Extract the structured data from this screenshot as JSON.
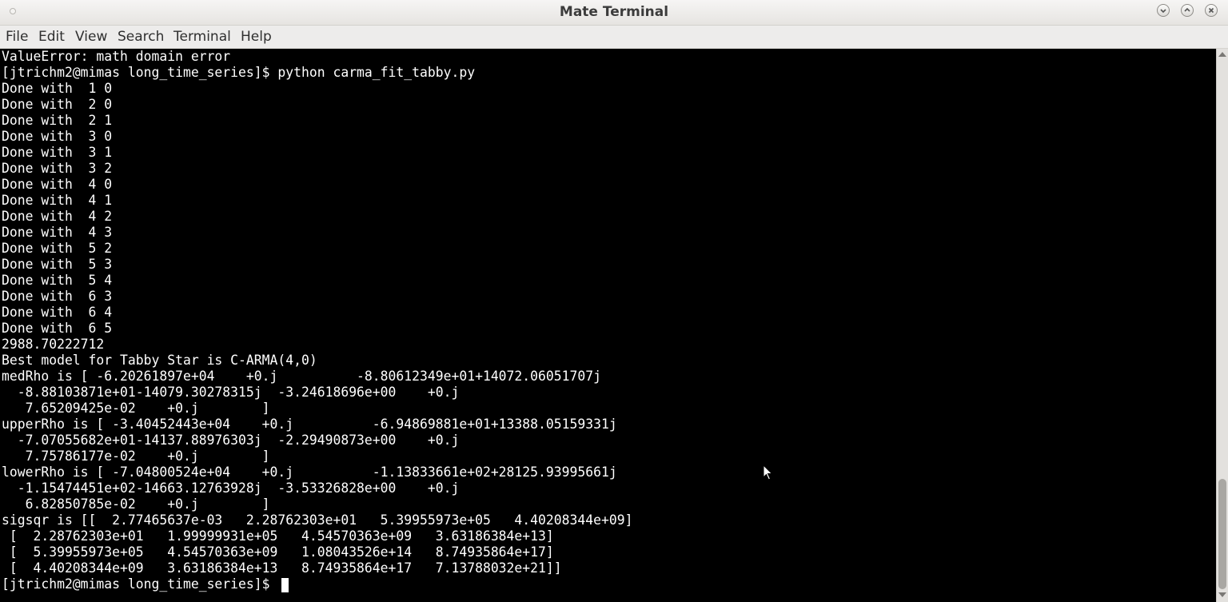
{
  "window": {
    "title": "Mate Terminal"
  },
  "menubar": {
    "items": [
      "File",
      "Edit",
      "View",
      "Search",
      "Terminal",
      "Help"
    ]
  },
  "terminal": {
    "lines": [
      "ValueError: math domain error",
      "[jtrichm2@mimas long_time_series]$ python carma_fit_tabby.py",
      "Done with  1 0",
      "Done with  2 0",
      "Done with  2 1",
      "Done with  3 0",
      "Done with  3 1",
      "Done with  3 2",
      "Done with  4 0",
      "Done with  4 1",
      "Done with  4 2",
      "Done with  4 3",
      "Done with  5 2",
      "Done with  5 3",
      "Done with  5 4",
      "Done with  6 3",
      "Done with  6 4",
      "Done with  6 5",
      "2988.70222712",
      "Best model for Tabby Star is C-ARMA(4,0)",
      "medRho is [ -6.20261897e+04    +0.j          -8.80612349e+01+14072.06051707j",
      "  -8.88103871e+01-14079.30278315j  -3.24618696e+00    +0.j",
      "   7.65209425e-02    +0.j        ]",
      "upperRho is [ -3.40452443e+04    +0.j          -6.94869881e+01+13388.05159331j",
      "  -7.07055682e+01-14137.88976303j  -2.29490873e+00    +0.j",
      "   7.75786177e-02    +0.j        ]",
      "lowerRho is [ -7.04800524e+04    +0.j          -1.13833661e+02+28125.93995661j",
      "  -1.15474451e+02-14663.12763928j  -3.53326828e+00    +0.j",
      "   6.82850785e-02    +0.j        ]",
      "sigsqr is [[  2.77465637e-03   2.28762303e+01   5.39955973e+05   4.40208344e+09]",
      " [  2.28762303e+01   1.99999931e+05   4.54570363e+09   3.63186384e+13]",
      " [  5.39955973e+05   4.54570363e+09   1.08043526e+14   8.74935864e+17]",
      " [  4.40208344e+09   3.63186384e+13   8.74935864e+17   7.13788032e+21]]",
      "[jtrichm2@mimas long_time_series]$ "
    ]
  },
  "icons": {
    "minimize": "minimize-icon",
    "maximize": "maximize-icon",
    "close": "close-icon",
    "pointer": "mouse-pointer-icon"
  },
  "colors": {
    "terminal_bg": "#000000",
    "terminal_fg": "#ffffff",
    "chrome_bg": "#edeceb"
  }
}
